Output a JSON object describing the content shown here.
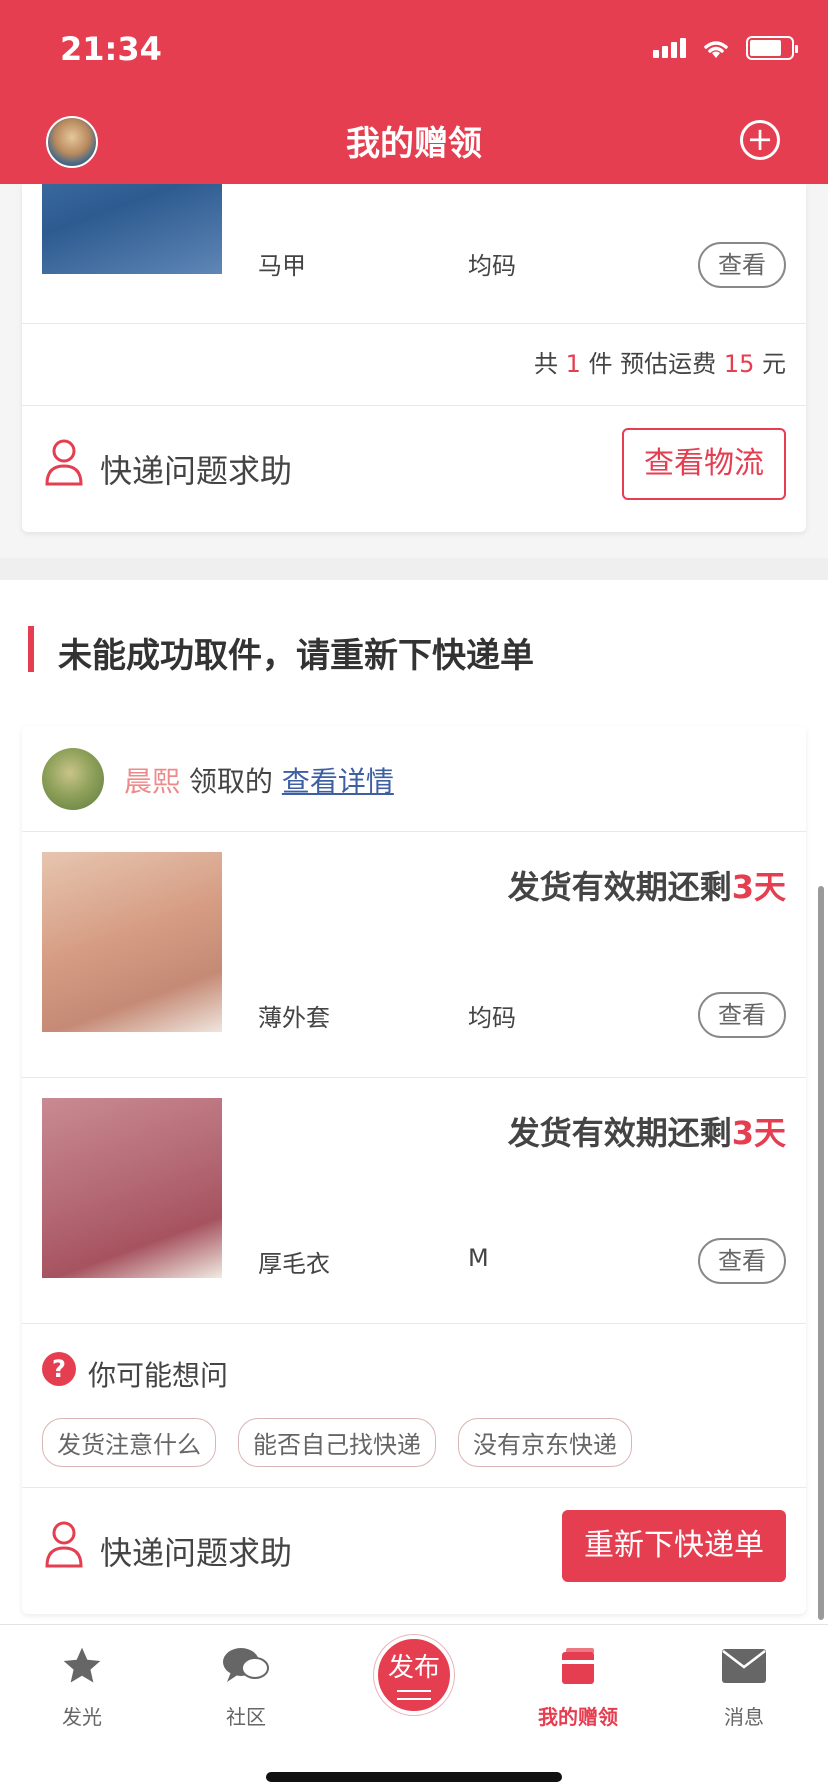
{
  "status_bar": {
    "time": "21:34"
  },
  "header": {
    "title": "我的赠领"
  },
  "card1": {
    "item": {
      "name": "马甲",
      "size": "均码",
      "view_label": "查看"
    },
    "summary": {
      "prefix": "共",
      "count": "1",
      "count_unit": "件 预估运费",
      "fee": "15",
      "fee_unit": "元"
    },
    "help_label": "快递问题求助",
    "logistics_button": "查看物流"
  },
  "section2": {
    "title": "未能成功取件，请重新下快递单",
    "claimer": {
      "name": "晨熙",
      "action": "领取的",
      "detail_link": "查看详情"
    },
    "items": [
      {
        "deadline_text": "发货有效期还剩",
        "deadline_days": "3天",
        "name": "薄外套",
        "size": "均码",
        "view_label": "查看"
      },
      {
        "deadline_text": "发货有效期还剩",
        "deadline_days": "3天",
        "name": "厚毛衣",
        "size": "M",
        "view_label": "查看"
      }
    ],
    "faq": {
      "title": "你可能想问",
      "tags": [
        "发货注意什么",
        "能否自己找快递",
        "没有京东快递"
      ]
    },
    "help_label": "快递问题求助",
    "reorder_button": "重新下快递单"
  },
  "tabbar": {
    "items": [
      {
        "label": "发光",
        "icon": "star-icon"
      },
      {
        "label": "社区",
        "icon": "chat-bubble-icon"
      },
      {
        "label": "发布",
        "icon": "publish-icon"
      },
      {
        "label": "我的赠领",
        "icon": "gift-book-icon"
      },
      {
        "label": "消息",
        "icon": "mail-icon"
      }
    ],
    "active": "我的赠领"
  },
  "colors": {
    "brand": "#e53e50",
    "link": "#3f5fa3",
    "claimer_name": "#ef8a8a"
  }
}
